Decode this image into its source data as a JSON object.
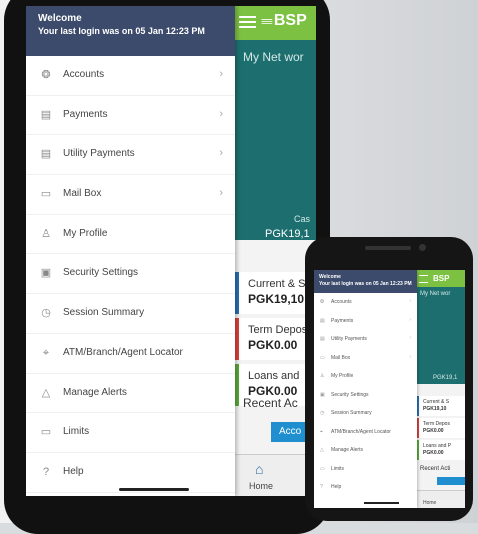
{
  "drawer": {
    "welcome": "Welcome",
    "last_login": "Your last login was on 05 Jan 12:23 PM",
    "items": [
      {
        "label": "Accounts",
        "icon": "accounts-icon",
        "glyph": "❂",
        "chevron": true
      },
      {
        "label": "Payments",
        "icon": "payments-icon",
        "glyph": "▤",
        "chevron": true
      },
      {
        "label": "Utility Payments",
        "icon": "utility-icon",
        "glyph": "▤",
        "chevron": true
      },
      {
        "label": "Mail Box",
        "icon": "mailbox-icon",
        "glyph": "▭",
        "chevron": true
      },
      {
        "label": "My Profile",
        "icon": "profile-icon",
        "glyph": "♙",
        "chevron": false
      },
      {
        "label": "Security Settings",
        "icon": "security-icon",
        "glyph": "▣",
        "chevron": false
      },
      {
        "label": "Session Summary",
        "icon": "clock-icon",
        "glyph": "◷",
        "chevron": false
      },
      {
        "label": "ATM/Branch/Agent Locator",
        "icon": "location-pin-icon",
        "glyph": "⌖",
        "chevron": false
      },
      {
        "label": "Manage Alerts",
        "icon": "warning-icon",
        "glyph": "△",
        "chevron": false
      },
      {
        "label": "Limits",
        "icon": "card-icon",
        "glyph": "▭",
        "chevron": false
      },
      {
        "label": "Help",
        "icon": "help-icon",
        "glyph": "?",
        "chevron": false
      }
    ]
  },
  "app": {
    "logo": "BSP",
    "logo_mark": "≡≡",
    "networth_label": "My Net wor",
    "cash_label": "Cas",
    "cash_amount": "PGK19,1",
    "cards": [
      {
        "title": "Current & S",
        "amount": "PGK19,10",
        "color": "#2b6fb3"
      },
      {
        "title": "Term Depos",
        "amount": "PGK0.00",
        "color": "#d9443f"
      },
      {
        "title": "Loans and",
        "amount": "PGK0.00",
        "color": "#5cab3c"
      }
    ],
    "recent_label": "Recent Ac",
    "accounts_button": "Acco",
    "home_label": "Home",
    "home_glyph": "⌂"
  },
  "phone": {
    "networth_label": "My Net wor",
    "cash_amount": "PGK19,1",
    "cards": [
      {
        "title": "Current & S",
        "amount": "PGK19,10",
        "color": "#2b6fb3"
      },
      {
        "title": "Term Depos",
        "amount": "PGK0.00",
        "color": "#d9443f"
      },
      {
        "title": "Loans and P",
        "amount": "PGK0.00",
        "color": "#5cab3c"
      }
    ],
    "recent_label": "Recent Acti",
    "home_label": "Home"
  },
  "chevron_glyph": "›"
}
